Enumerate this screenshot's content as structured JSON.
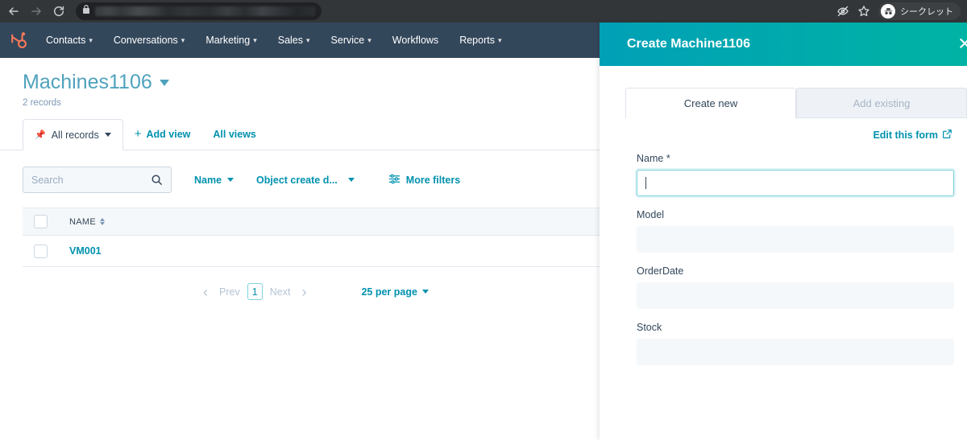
{
  "browser": {
    "back_icon": "arrow-left-icon",
    "forward_icon": "arrow-right-icon",
    "reload_icon": "reload-icon",
    "lock_icon": "lock-icon",
    "url_value": "",
    "url_placeholder": "",
    "blocked_icon": "eye-slash-icon",
    "bookmark_icon": "star-icon",
    "incognito_label": "シークレット",
    "incognito_icon": "incognito-avatar-icon"
  },
  "topnav": {
    "logo": "hubspot-sprocket-logo",
    "items": [
      {
        "label": "Contacts",
        "has_caret": true
      },
      {
        "label": "Conversations",
        "has_caret": true
      },
      {
        "label": "Marketing",
        "has_caret": true
      },
      {
        "label": "Sales",
        "has_caret": true
      },
      {
        "label": "Service",
        "has_caret": true
      },
      {
        "label": "Workflows",
        "has_caret": false
      },
      {
        "label": "Reports",
        "has_caret": true
      }
    ]
  },
  "page": {
    "title": "Machines1106",
    "record_count": "2 records"
  },
  "view_tabs": {
    "active_tab": "All records",
    "pin_icon": "pin-icon",
    "add_view": "Add view",
    "all_views": "All views"
  },
  "filters": {
    "search_placeholder": "Search",
    "search_value": "",
    "search_icon": "search-icon",
    "chips": [
      {
        "label": "Name"
      },
      {
        "label": "Object create d..."
      }
    ],
    "more_filters_label": "More filters",
    "more_filters_icon": "sliders-icon"
  },
  "table": {
    "columns": [
      "NAME"
    ],
    "rows": [
      {
        "name": "VM001"
      }
    ]
  },
  "pagination": {
    "prev_label": "Prev",
    "next_label": "Next",
    "current_page": "1",
    "per_page_label": "25 per page"
  },
  "panel": {
    "title": "Create Machine1106",
    "close_icon": "close-icon",
    "tabs": [
      {
        "label": "Create new",
        "active": true
      },
      {
        "label": "Add existing",
        "active": false
      }
    ],
    "edit_form_label": "Edit this form",
    "edit_form_icon": "external-link-icon",
    "fields": [
      {
        "label": "Name *",
        "value": "",
        "focused": true
      },
      {
        "label": "Model",
        "value": "",
        "focused": false
      },
      {
        "label": "OrderDate",
        "value": "",
        "focused": false
      },
      {
        "label": "Stock",
        "value": "",
        "focused": false
      }
    ]
  },
  "colors": {
    "hubspot_navy": "#33475b",
    "teal_link": "#0091ae",
    "panel_teal_start": "#00a0b6",
    "panel_teal_end": "#00b3a4",
    "orange_logo": "#ff7a59"
  }
}
